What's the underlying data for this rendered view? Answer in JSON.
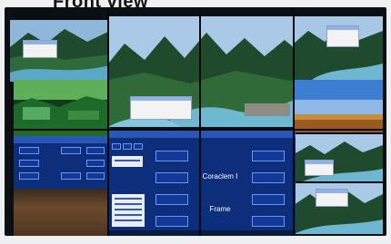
{
  "caption": "Front view",
  "app_center": {
    "title_label": "Coraclem I",
    "frame_label": "Frame"
  }
}
